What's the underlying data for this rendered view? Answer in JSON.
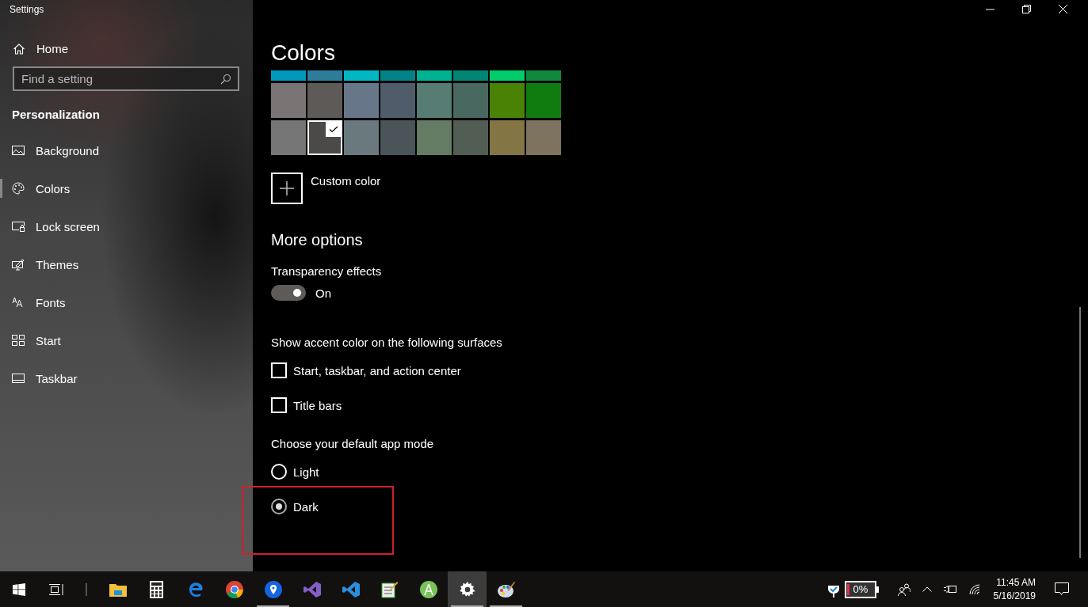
{
  "window": {
    "title": "Settings"
  },
  "sidebar": {
    "home": "Home",
    "search": {
      "placeholder": "Find a setting"
    },
    "section": "Personalization",
    "items": [
      {
        "label": "Background",
        "selected": false
      },
      {
        "label": "Colors",
        "selected": true
      },
      {
        "label": "Lock screen",
        "selected": false
      },
      {
        "label": "Themes",
        "selected": false
      },
      {
        "label": "Fonts",
        "selected": false
      },
      {
        "label": "Start",
        "selected": false
      },
      {
        "label": "Taskbar",
        "selected": false
      }
    ]
  },
  "content": {
    "title": "Colors",
    "swatch_rows": [
      [
        {
          "color": "#0099bc",
          "selected": false
        },
        {
          "color": "#2d7d9a",
          "selected": false
        },
        {
          "color": "#00b7c3",
          "selected": false
        },
        {
          "color": "#038387",
          "selected": false
        },
        {
          "color": "#00b294",
          "selected": false
        },
        {
          "color": "#018574",
          "selected": false
        },
        {
          "color": "#00cc6a",
          "selected": false
        },
        {
          "color": "#10893e",
          "selected": false
        }
      ],
      [
        {
          "color": "#7a7574",
          "selected": false
        },
        {
          "color": "#5d5a58",
          "selected": false
        },
        {
          "color": "#68768a",
          "selected": false
        },
        {
          "color": "#515c6b",
          "selected": false
        },
        {
          "color": "#567c73",
          "selected": false
        },
        {
          "color": "#486860",
          "selected": false
        },
        {
          "color": "#498205",
          "selected": false
        },
        {
          "color": "#107c10",
          "selected": false
        }
      ],
      [
        {
          "color": "#767676",
          "selected": false
        },
        {
          "color": "#4c4a48",
          "selected": true
        },
        {
          "color": "#69797e",
          "selected": false
        },
        {
          "color": "#4a5459",
          "selected": false
        },
        {
          "color": "#647c64",
          "selected": false
        },
        {
          "color": "#525e54",
          "selected": false
        },
        {
          "color": "#847545",
          "selected": false
        },
        {
          "color": "#7e735f",
          "selected": false
        }
      ]
    ],
    "custom_color": "Custom color",
    "more_options": "More options",
    "transparency": {
      "label": "Transparency effects",
      "on": true,
      "state": "On"
    },
    "accent_heading": "Show accent color on the following surfaces",
    "accent_surfaces": [
      {
        "label": "Start, taskbar, and action center",
        "checked": false
      },
      {
        "label": "Title bars",
        "checked": false
      }
    ],
    "app_mode_heading": "Choose your default app mode",
    "app_modes": [
      {
        "label": "Light",
        "selected": false
      },
      {
        "label": "Dark",
        "selected": true
      }
    ]
  },
  "taskbar": {
    "apps": [
      {
        "selected": false,
        "running": false
      },
      {
        "selected": false,
        "running": false
      },
      {
        "selected": false,
        "running": false
      },
      {
        "selected": false,
        "running": false
      },
      {
        "selected": false,
        "running": true
      },
      {
        "selected": false,
        "running": false
      },
      {
        "selected": false,
        "running": false
      },
      {
        "selected": false,
        "running": false
      },
      {
        "selected": false,
        "running": false
      },
      {
        "selected": true,
        "running": true
      },
      {
        "selected": false,
        "running": true
      }
    ],
    "battery": "0%",
    "time": "11:45 AM",
    "date": "5/16/2019"
  }
}
